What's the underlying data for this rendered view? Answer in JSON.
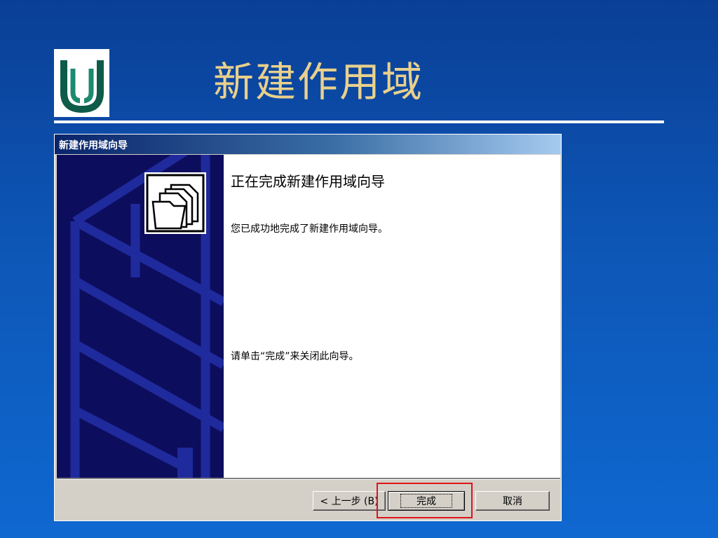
{
  "slide": {
    "title": "新建作用域",
    "logo_icon": "company-logo-icon",
    "accent_color": "#e9d08c",
    "background_color": "#0d56b6"
  },
  "dialog": {
    "title": "新建作用域向导",
    "heading": "正在完成新建作用域向导",
    "message": "您已成功地完成了新建作用域向导。",
    "instruction": "请单击“完成”来关闭此向导。",
    "wizard_icon": "folders-icon",
    "buttons": {
      "back": "< 上一步 (B)",
      "finish": "完成",
      "cancel": "取消"
    },
    "highlight_color": "#e0141c"
  }
}
